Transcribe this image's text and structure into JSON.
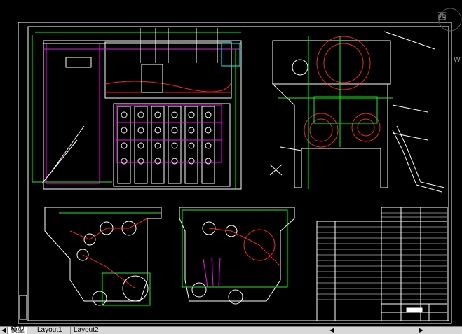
{
  "viewcube": {
    "label": "西",
    "wcs_label": "W"
  },
  "tabs": [
    {
      "label": "模型"
    },
    {
      "label": "Layout1"
    },
    {
      "label": "Layout2"
    }
  ],
  "colors": {
    "background": "#000000",
    "frame": "#ffffff",
    "green": "#00ff00",
    "magenta": "#ff00ff",
    "red": "#ff2020",
    "yellow": "#ffff00",
    "cyan": "#00ffff"
  },
  "drawing": {
    "views": [
      "front-view",
      "side-view",
      "section-view-left",
      "section-view-right",
      "parts-table",
      "title-block"
    ]
  }
}
